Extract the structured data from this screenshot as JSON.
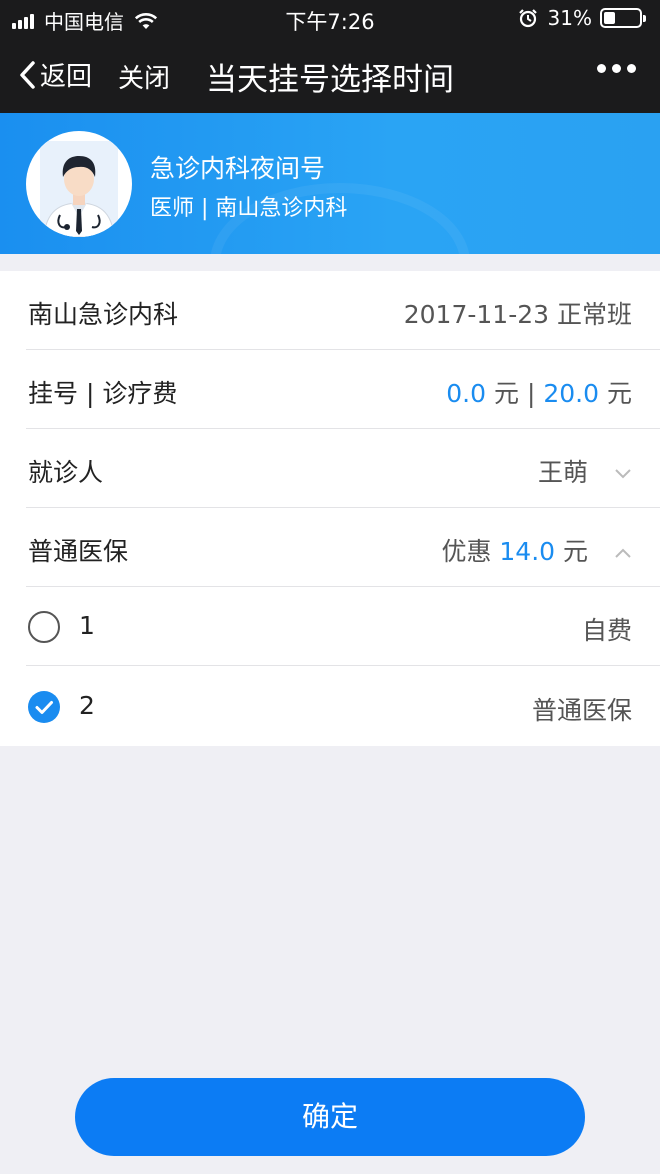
{
  "status_bar": {
    "carrier": "中国电信",
    "time": "下午7:26",
    "battery": "31%",
    "battery_level": 0.31,
    "icons": [
      "signal-icon",
      "wifi-icon",
      "alarm-icon",
      "battery-icon"
    ]
  },
  "nav": {
    "back": "返回",
    "close": "关闭",
    "title": "当天挂号选择时间",
    "more_icon": "more-icon"
  },
  "doctor": {
    "name": "急诊内科夜间号",
    "subtitle": "医师 | 南山急诊内科"
  },
  "rows": {
    "department": {
      "label": "南山急诊内科",
      "value": "2017-11-23 正常班"
    },
    "fee": {
      "label": "挂号 | 诊疗费",
      "reg_fee": "0.0",
      "unit1": "元",
      "sep": "|",
      "treat_fee": "20.0",
      "unit2": "元"
    },
    "patient": {
      "label": "就诊人",
      "value": "王萌"
    },
    "insurance": {
      "label": "普通医保",
      "prefix": "优惠",
      "discount": "14.0",
      "unit": "元"
    },
    "option1": {
      "label": "1",
      "value": "自费",
      "checked": false
    },
    "option2": {
      "label": "2",
      "value": "普通医保",
      "checked": true
    }
  },
  "confirm_label": "确定",
  "colors": {
    "accent": "#1a8cf0",
    "nav_bg": "#1b1b1c",
    "button": "#0c7cf4"
  }
}
